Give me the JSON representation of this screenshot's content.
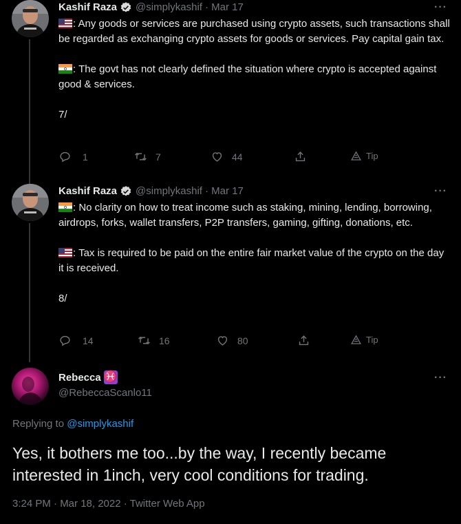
{
  "tweets": [
    {
      "name": "Kashif Raza",
      "handle": "@simplykashif",
      "date": "· Mar 17",
      "more": "···",
      "para1_flag": "us-flag",
      "para1": ": Any goods or services are purchased using crypto assets, such transactions shall be regarded as exchanging crypto assets for goods or services. Pay capital gain tax.",
      "para2_flag": "india-flag",
      "para2": ": The govt has not clearly defined the situation where crypto is accepted against good & services.",
      "para3": "7/",
      "replies": "1",
      "retweets": "7",
      "likes": "44",
      "tip": "Tip"
    },
    {
      "name": "Kashif Raza",
      "handle": "@simplykashif",
      "date": "· Mar 17",
      "more": "···",
      "para1_flag": "india-flag",
      "para1": ": No clarity on how to treat income such as staking, mining, lending, borrowing, airdrops, forks, wallet transfers, P2P transfers, gaming, gifting, donations, etc.",
      "para2_flag": "us-flag",
      "para2": ": Tax is required to be paid on the entire fair market value of the crypto on the day it is received.",
      "para3": "8/",
      "replies": "14",
      "retweets": "16",
      "likes": "80",
      "tip": "Tip"
    }
  ],
  "reply": {
    "name": "Rebecca",
    "emoji": "♓",
    "handle": "@RebeccaScanlo11",
    "more": "···",
    "replying_prefix": "Replying to",
    "replying_to": "@simplykashif",
    "text": "Yes, it bothers me too...by the way, I recently became interested in 1inch, very cool conditions for trading.",
    "timestamp": "3:24 PM · Mar 18, 2022 · Twitter Web App"
  },
  "colors": {
    "background": "#000000",
    "text": "#e7e9ea",
    "muted": "#71767b",
    "link": "#1d9bf0",
    "verified": "#d9d9d9"
  }
}
